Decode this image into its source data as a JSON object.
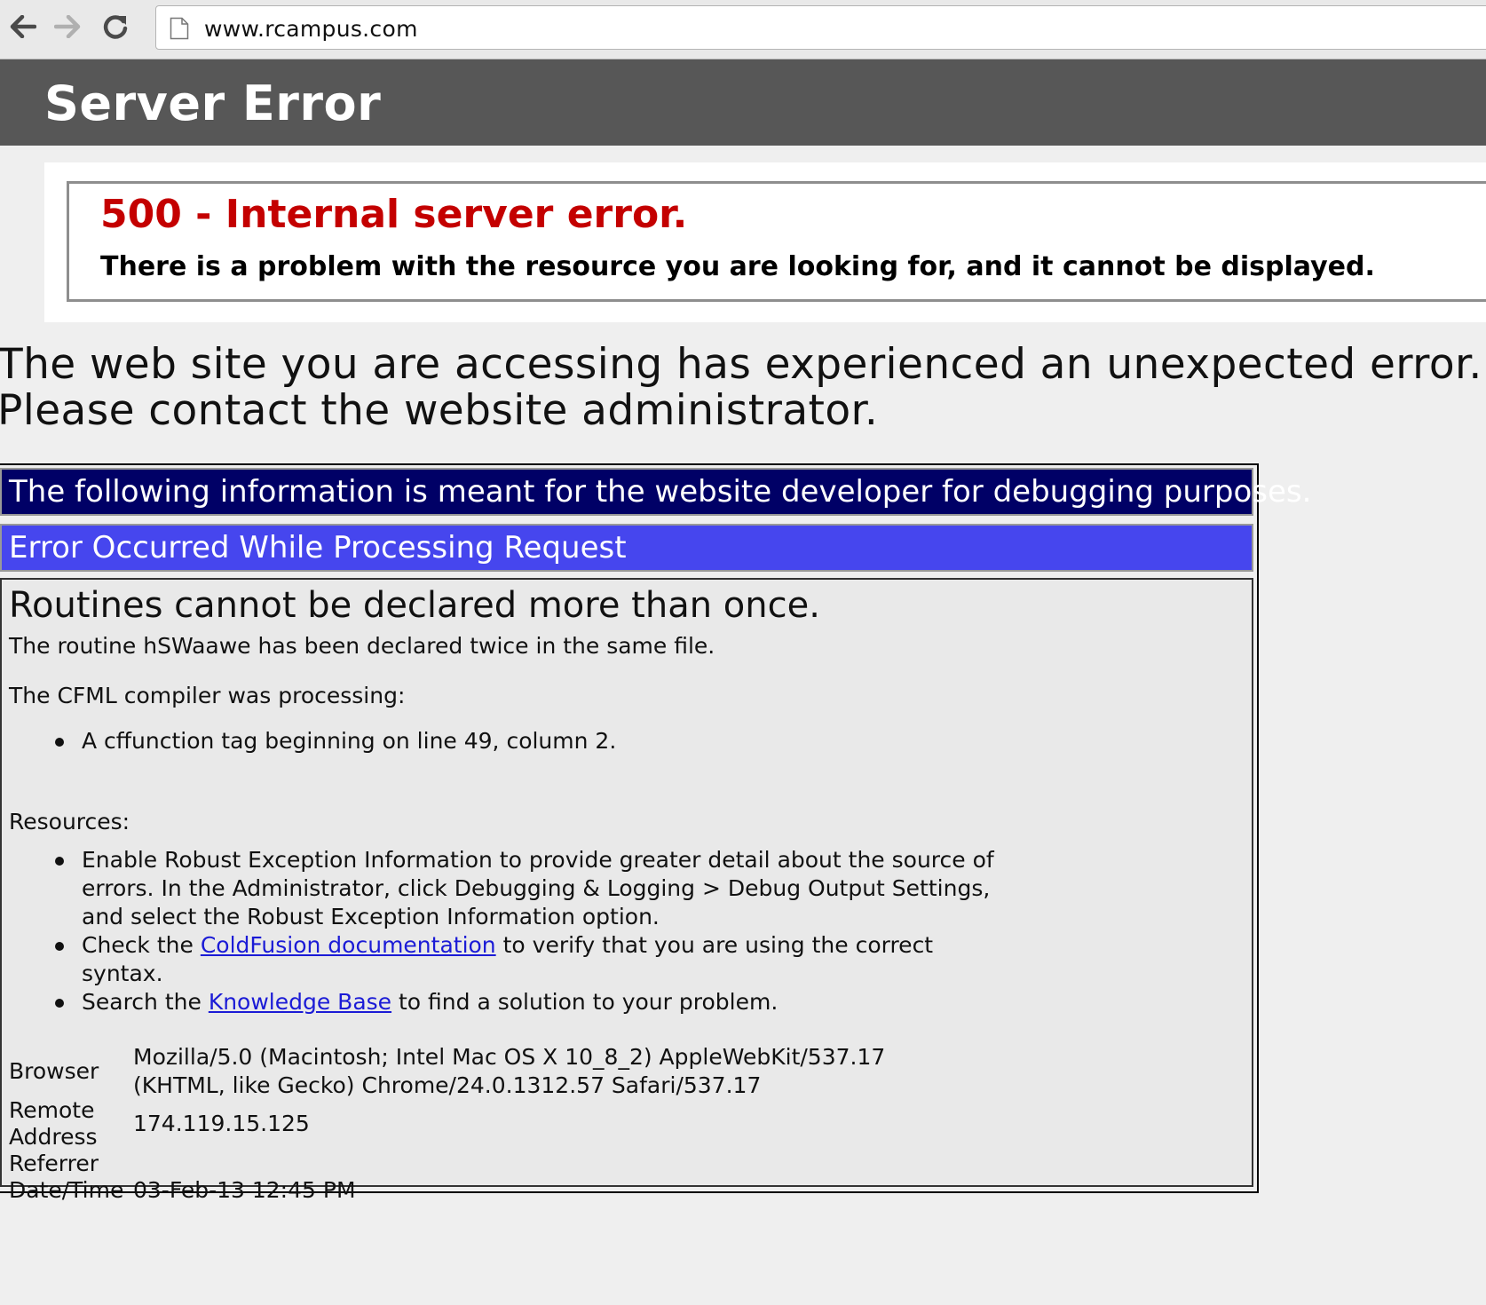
{
  "browser": {
    "url": "www.rcampus.com",
    "back_icon": "back-arrow-icon",
    "forward_icon": "forward-arrow-icon",
    "reload_icon": "reload-icon",
    "page_icon": "page-icon"
  },
  "header": {
    "title": "Server Error"
  },
  "iis_error": {
    "title": "500 - Internal server error.",
    "description": "There is a problem with the resource you are looking for, and it cannot be displayed."
  },
  "intro": {
    "line1": "The web site you are accessing has experienced an unexpected error.",
    "line2": "Please contact the website administrator."
  },
  "debug": {
    "banner": "The following information is meant for the website developer for debugging purposes.",
    "title": "Error Occurred While Processing Request",
    "heading": "Routines cannot be declared more than once.",
    "description": "The routine hSWaawe has been declared twice in the same file.",
    "processing_label": "The CFML compiler was processing:",
    "processing_items": [
      "A cffunction tag beginning on line 49, column 2."
    ],
    "resources_label": "Resources:",
    "resources": {
      "item1": "Enable Robust Exception Information to provide greater detail about the source of errors. In the Administrator, click Debugging & Logging > Debug Output Settings, and select the Robust Exception Information option.",
      "item2_prefix": "Check the ",
      "item2_link": "ColdFusion documentation",
      "item2_suffix": " to verify that you are using the correct syntax.",
      "item3_prefix": "Search the ",
      "item3_link": "Knowledge Base",
      "item3_suffix": " to find a solution to your problem."
    },
    "info": {
      "browser_label": "Browser",
      "browser_value": "Mozilla/5.0 (Macintosh; Intel Mac OS X 10_8_2) AppleWebKit/537.17 (KHTML, like Gecko) Chrome/24.0.1312.57 Safari/537.17",
      "remote_label_1": "Remote",
      "remote_label_2": "Address",
      "remote_value": "174.119.15.125",
      "referrer_label": "Referrer",
      "datetime_label": "Date/Time",
      "datetime_value": "03-Feb-13 12:45 PM"
    }
  },
  "colors": {
    "header_bg": "#575757",
    "error_red": "#c40000",
    "banner_navy": "#000066",
    "title_blue": "#4646ee",
    "link_blue": "#1b1bd6"
  }
}
